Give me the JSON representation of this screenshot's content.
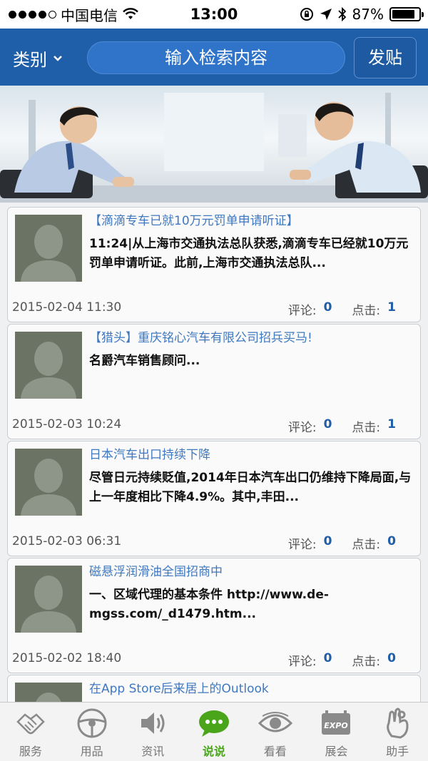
{
  "status_bar": {
    "carrier": "中国电信",
    "time": "13:00",
    "battery": "87%",
    "battery_level": 0.87
  },
  "nav": {
    "category_label": "类别",
    "search_placeholder": "输入检索内容",
    "post_label": "发贴"
  },
  "posts": [
    {
      "title": "【滴滴专车已就10万元罚单申请听证】",
      "excerpt": "11:24|从上海市交通执法总队获悉,滴滴专车已经就10万元罚单申请听证。此前,上海市交通执法总队...",
      "date": "2015-02-04 11:30",
      "comments_label": "评论:",
      "comments": "0",
      "clicks_label": "点击:",
      "clicks": "1"
    },
    {
      "title": "【猎头】重庆铭心汽车有限公司招兵买马!",
      "excerpt": "名爵汽车销售顾问...",
      "date": "2015-02-03 10:24",
      "comments_label": "评论:",
      "comments": "0",
      "clicks_label": "点击:",
      "clicks": "1"
    },
    {
      "title": "日本汽车出口持续下降",
      "excerpt": "尽管日元持续贬值,2014年日本汽车出口仍维持下降局面,与上一年度相比下降4.9%。其中,丰田...",
      "date": "2015-02-03 06:31",
      "comments_label": "评论:",
      "comments": "0",
      "clicks_label": "点击:",
      "clicks": "0"
    },
    {
      "title": "磁悬浮润滑油全国招商中",
      "excerpt": "一、区域代理的基本条件 http://www.de-mgss.com/_d1479.htm...",
      "date": "2015-02-02 18:40",
      "comments_label": "评论:",
      "comments": "0",
      "clicks_label": "点击:",
      "clicks": "0"
    },
    {
      "title": "在App Store后来居上的Outlook",
      "excerpt": "",
      "date": "",
      "comments_label": "",
      "comments": "",
      "clicks_label": "",
      "clicks": ""
    }
  ],
  "tabs": [
    {
      "label": "服务",
      "icon": "handshake-icon"
    },
    {
      "label": "用品",
      "icon": "steering-wheel-icon"
    },
    {
      "label": "资讯",
      "icon": "speaker-icon"
    },
    {
      "label": "说说",
      "icon": "chat-bubble-icon",
      "active": true
    },
    {
      "label": "看看",
      "icon": "eye-icon"
    },
    {
      "label": "展会",
      "icon": "expo-icon"
    },
    {
      "label": "助手",
      "icon": "helper-hand-icon"
    }
  ],
  "colors": {
    "nav_blue": "#1f5ea8",
    "title_blue": "#3f78bf",
    "active_green": "#4aa51b"
  }
}
